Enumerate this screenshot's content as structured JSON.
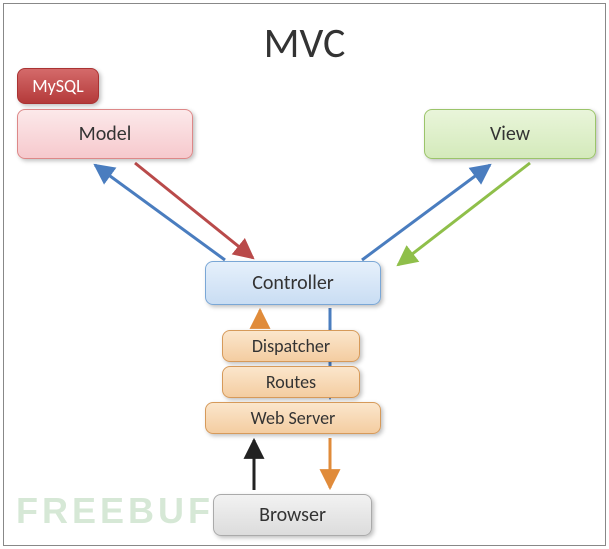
{
  "title": "MVC",
  "nodes": {
    "mysql": "MySQL",
    "model": "Model",
    "view": "View",
    "controller": "Controller",
    "dispatcher": "Dispatcher",
    "routes": "Routes",
    "webserver": "Web Server",
    "browser": "Browser"
  },
  "watermark": "FREEBUF",
  "chart_data": {
    "type": "diagram",
    "title": "MVC",
    "nodes": [
      {
        "id": "mysql",
        "label": "MySQL",
        "color": "#b43a3a"
      },
      {
        "id": "model",
        "label": "Model",
        "color": "#f6c9cd"
      },
      {
        "id": "view",
        "label": "View",
        "color": "#d4eabb"
      },
      {
        "id": "controller",
        "label": "Controller",
        "color": "#c9ddf3"
      },
      {
        "id": "dispatcher",
        "label": "Dispatcher",
        "color": "#f4cda1"
      },
      {
        "id": "routes",
        "label": "Routes",
        "color": "#f4cda1"
      },
      {
        "id": "webserver",
        "label": "Web Server",
        "color": "#f4cda1"
      },
      {
        "id": "browser",
        "label": "Browser",
        "color": "#dcdcdc"
      }
    ],
    "edges": [
      {
        "from": "controller",
        "to": "model",
        "color": "blue"
      },
      {
        "from": "model",
        "to": "controller",
        "color": "red"
      },
      {
        "from": "controller",
        "to": "view",
        "color": "blue"
      },
      {
        "from": "view",
        "to": "controller",
        "color": "green"
      },
      {
        "from": "dispatcher",
        "to": "controller",
        "color": "orange",
        "via": [
          "routes",
          "dispatcher"
        ]
      },
      {
        "from": "controller",
        "to": "webserver",
        "color": "blue"
      },
      {
        "from": "browser",
        "to": "webserver",
        "color": "black"
      },
      {
        "from": "webserver",
        "to": "browser",
        "color": "orange"
      }
    ]
  }
}
